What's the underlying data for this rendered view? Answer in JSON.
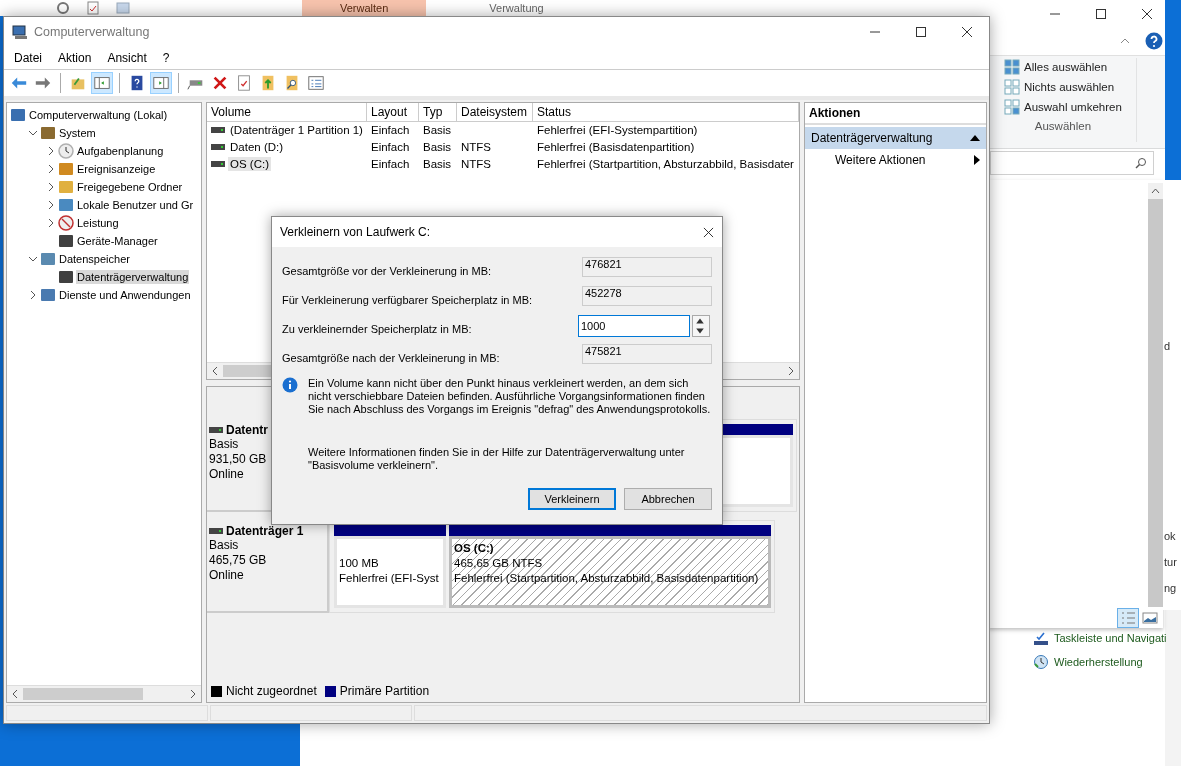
{
  "back_window": {
    "ribbon_tabs": [
      {
        "label": "Verwalten",
        "selected": true
      },
      {
        "label": "Verwaltung",
        "selected": false
      }
    ]
  },
  "explorer": {
    "ribbon_buttons": [
      {
        "label": "Alles auswählen",
        "kind": "all"
      },
      {
        "label": "Nichts auswählen",
        "kind": "none"
      },
      {
        "label": "Auswahl umkehren",
        "kind": "invert"
      }
    ],
    "group_label": "Auswählen",
    "fragments": [
      "d",
      "ok",
      "tur",
      "ng"
    ],
    "nav_items": [
      {
        "label": "Taskleiste und Navigati",
        "kind": "taskbar"
      },
      {
        "label": "Wiederherstellung",
        "kind": "restore"
      }
    ]
  },
  "window": {
    "title": "Computerverwaltung",
    "menu": [
      "Datei",
      "Aktion",
      "Ansicht",
      "?"
    ],
    "toolbar": [
      {
        "kind": "back",
        "pressed": false
      },
      {
        "kind": "forward",
        "pressed": false
      },
      {
        "kind": "sep"
      },
      {
        "kind": "up",
        "pressed": false
      },
      {
        "kind": "tree",
        "pressed": true
      },
      {
        "kind": "sep"
      },
      {
        "kind": "help",
        "pressed": false
      },
      {
        "kind": "pane",
        "pressed": true
      },
      {
        "kind": "sep"
      },
      {
        "kind": "connect",
        "pressed": false
      },
      {
        "kind": "delete",
        "pressed": false
      },
      {
        "kind": "props",
        "pressed": false
      },
      {
        "kind": "import",
        "pressed": false
      },
      {
        "kind": "find",
        "pressed": false
      },
      {
        "kind": "list",
        "pressed": false
      }
    ]
  },
  "tree": [
    {
      "label": "Computerverwaltung (Lokal)",
      "selected": false,
      "children": [
        {
          "label": "System",
          "expanded": true,
          "selected": false,
          "children": [
            {
              "label": "Aufgabenplanung",
              "expanded": false,
              "selected": false
            },
            {
              "label": "Ereignisanzeige",
              "expanded": false,
              "selected": false
            },
            {
              "label": "Freigegebene Ordner",
              "expanded": false,
              "selected": false
            },
            {
              "label": "Lokale Benutzer und Gr",
              "expanded": false,
              "selected": false
            },
            {
              "label": "Leistung",
              "expanded": false,
              "selected": false
            },
            {
              "label": "Geräte-Manager",
              "selected": false
            }
          ]
        },
        {
          "label": "Datenspeicher",
          "expanded": true,
          "selected": false,
          "children": [
            {
              "label": "Datenträgerverwaltung",
              "selected": true
            }
          ]
        },
        {
          "label": "Dienste und Anwendungen",
          "expanded": false,
          "selected": false
        }
      ]
    }
  ],
  "volumes": {
    "columns": [
      "Volume",
      "Layout",
      "Typ",
      "Dateisystem",
      "Status"
    ],
    "rows": [
      {
        "cells": [
          "(Datenträger 1 Partition 1)",
          "Einfach",
          "Basis",
          null,
          "Fehlerfrei (EFI-Systempartition)"
        ],
        "selected": false
      },
      {
        "cells": [
          "Daten (D:)",
          "Einfach",
          "Basis",
          "NTFS",
          "Fehlerfrei (Basisdatenpartition)"
        ],
        "selected": false
      },
      {
        "cells": [
          "OS (C:)",
          "Einfach",
          "Basis",
          "NTFS",
          "Fehlerfrei (Startpartition, Absturzabbild, Basisdater"
        ],
        "selected": true
      }
    ]
  },
  "disks": [
    {
      "name": "Datentr",
      "type": "Basis",
      "size": "931,50 GB",
      "status": "Online",
      "partitions": [
        {
          "kind": "primary",
          "selected": false
        }
      ]
    },
    {
      "name": "Datenträger 1",
      "type": "Basis",
      "size": "465,75 GB",
      "status": "Online",
      "partitions": [
        {
          "kind": "primary",
          "selected": false,
          "lines": [
            "100 MB",
            "Fehlerfrei (EFI-Syst"
          ]
        },
        {
          "kind": "primary",
          "selected": true,
          "label": "OS  (C:)",
          "lines": [
            "465,65 GB NTFS",
            "Fehlerfrei (Startpartition, Absturzabbild, Basisdatenpartition)"
          ]
        }
      ]
    }
  ],
  "legend": [
    {
      "label": "Nicht zugeordnet",
      "color": "#000000"
    },
    {
      "label": "Primäre Partition",
      "color": "#000080"
    }
  ],
  "actions": {
    "header": "Aktionen",
    "items": [
      {
        "label": "Datenträgerverwaltung",
        "kind": "section",
        "selected": true
      },
      {
        "label": "Weitere Aktionen",
        "kind": "submenu",
        "selected": false
      }
    ]
  },
  "dialog": {
    "title": "Verkleinern von Laufwerk C:",
    "fields": [
      {
        "label": "Gesamtgröße vor der Verkleinerung in MB:",
        "value": "476821",
        "editable": false
      },
      {
        "label": "Für Verkleinerung verfügbarer Speicherplatz in MB:",
        "value": "452278",
        "editable": false
      },
      {
        "label": "Zu verkleinernder Speicherplatz in MB:",
        "value": "1000",
        "editable": true
      },
      {
        "label": "Gesamtgröße nach der Verkleinerung in MB:",
        "value": "475821",
        "editable": false
      }
    ],
    "info": "Ein Volume kann nicht über den Punkt hinaus verkleinert werden, an dem sich nicht verschiebbare Dateien befinden. Ausführliche Vorgangsinformationen finden Sie nach Abschluss des Vorgangs im Ereignis \"defrag\" des Anwendungsprotokolls.",
    "help": "Weitere Informationen finden Sie in der Hilfe zur Datenträgerverwaltung unter \"Basisvolume verkleinern\".",
    "buttons": [
      {
        "label": "Verkleinern",
        "default": true
      },
      {
        "label": "Abbrechen",
        "default": false
      }
    ]
  }
}
